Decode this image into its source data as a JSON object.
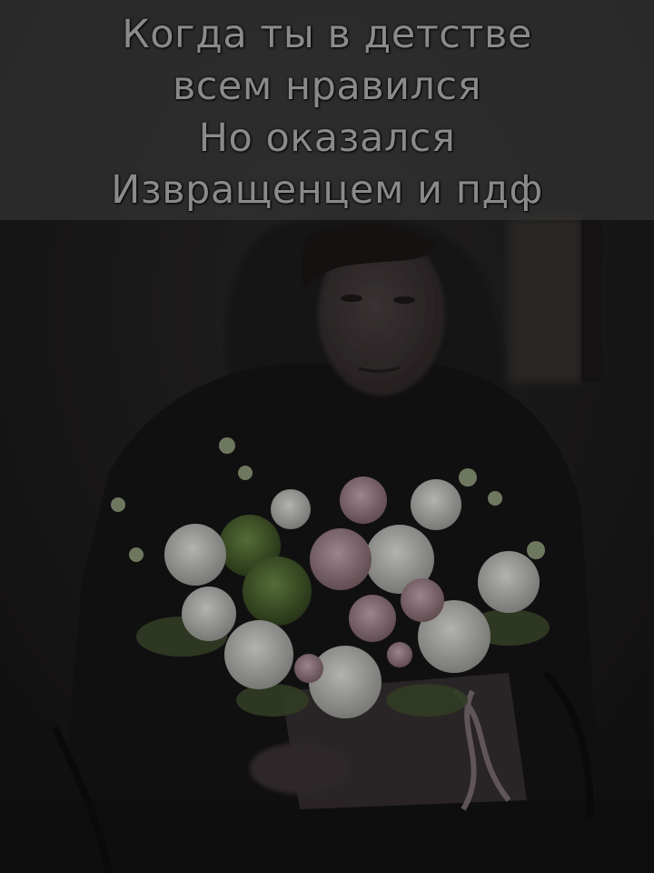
{
  "caption": {
    "lines": [
      "Когда ты в детстве",
      "всем нравился",
      "Но оказался",
      "Извращенцем и пдф"
    ]
  },
  "photo": {
    "subject": "person with long curly dark hair holding a bouquet of flowers",
    "bouquet_colors": [
      "#d7d9d4",
      "#b9a0a8",
      "#6f8f4d",
      "#c7b7bf"
    ],
    "background_color": "#1b1a1b"
  }
}
